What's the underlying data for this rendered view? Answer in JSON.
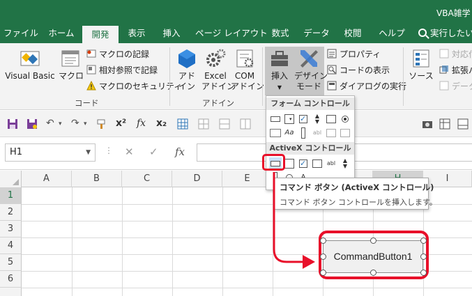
{
  "window": {
    "title": "VBA雑学 I"
  },
  "tabs": [
    {
      "label": "ファイル"
    },
    {
      "label": "ホーム"
    },
    {
      "label": "開発"
    },
    {
      "label": "表示"
    },
    {
      "label": "挿入"
    },
    {
      "label": "ページ レイアウト"
    },
    {
      "label": "数式"
    },
    {
      "label": "データ"
    },
    {
      "label": "校閲"
    },
    {
      "label": "ヘルプ"
    },
    {
      "label": "実行したい"
    }
  ],
  "ribbon": {
    "code": {
      "visual_basic": "Visual Basic",
      "macro": "マクロ",
      "record_macro": "マクロの記録",
      "relative_ref": "相対参照で記録",
      "macro_security": "マクロのセキュリティ",
      "group_label": "コード"
    },
    "addins": {
      "addin_line1": "アド",
      "addin_line2": "イン",
      "excel_addin_line1": "Excel",
      "excel_addin_line2": "アドイン",
      "com_addin_line1": "COM",
      "com_addin_line2": "アドイン",
      "group_label": "アドイン"
    },
    "controls": {
      "insert": "挿入",
      "design_line1": "デザイン",
      "design_line2": "モード",
      "properties": "プロパティ",
      "view_code": "コードの表示",
      "run_dialog": "ダイアログの実行"
    },
    "xml": {
      "source": "ソース",
      "map_props": "対応付",
      "expansion": "拡張パ",
      "data": "データ"
    }
  },
  "formula_bar": {
    "name_box": "H1",
    "fx": "fx",
    "value": ""
  },
  "dropdown": {
    "form_controls_header": "フォーム コントロール",
    "activex_header": "ActiveX コントロール"
  },
  "grid": {
    "columns": [
      "A",
      "B",
      "C",
      "D",
      "E",
      "F",
      "G",
      "H",
      "I"
    ],
    "rows": [
      "1",
      "2",
      "3",
      "4",
      "5",
      "6"
    ]
  },
  "tooltip": {
    "title": "コマンド ボタン (ActiveX コントロール)",
    "description": "コマンド ボタン コントロールを挿入します。"
  },
  "sheet_control": {
    "label": "CommandButton1"
  },
  "colors": {
    "excel_green": "#217346",
    "highlight_red": "#e8102a"
  }
}
